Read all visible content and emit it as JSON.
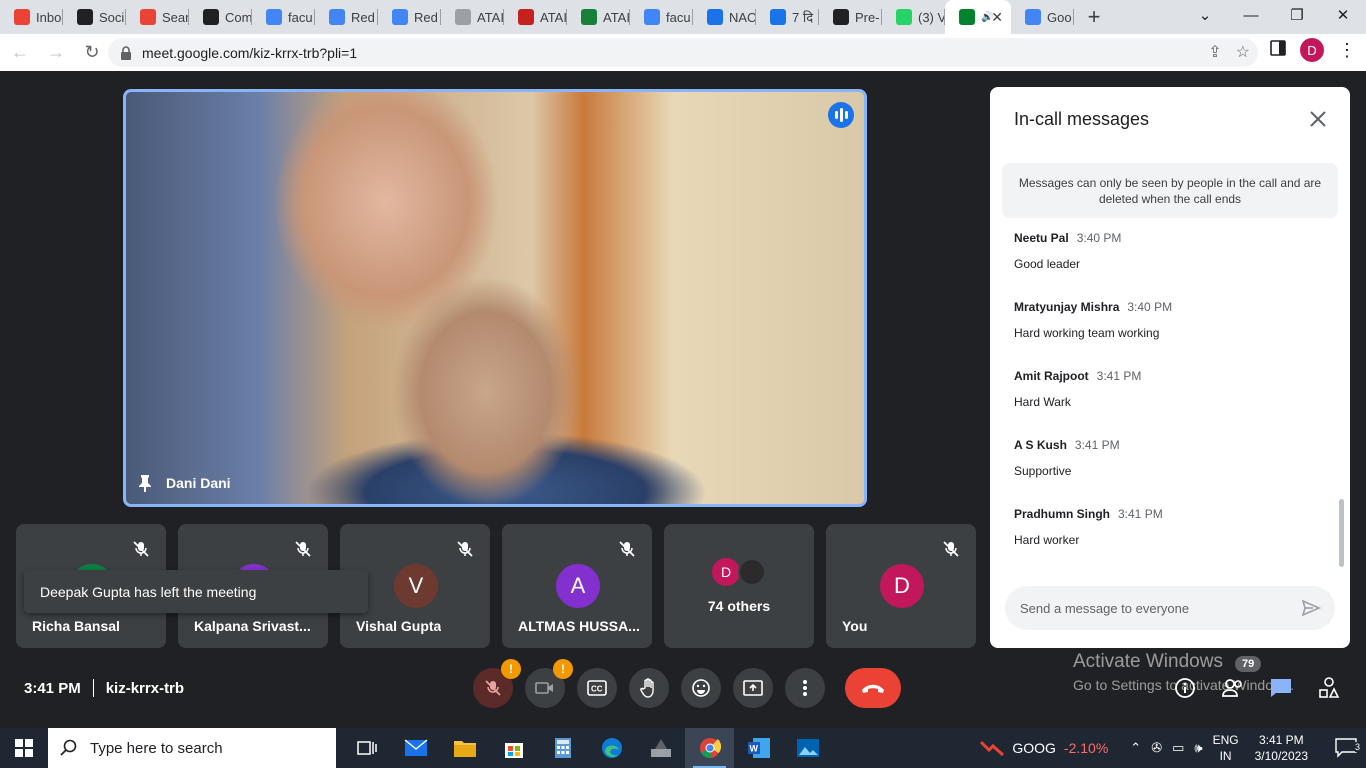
{
  "browser": {
    "tabs": [
      {
        "label": "Inbo",
        "icon": "gmail-icon",
        "color": "#ea4335"
      },
      {
        "label": "Soci",
        "icon": "app-icon",
        "color": "#202124"
      },
      {
        "label": "Sear",
        "icon": "gmail-icon",
        "color": "#ea4335"
      },
      {
        "label": "Com",
        "icon": "g-icon",
        "color": "#202124"
      },
      {
        "label": "facu",
        "icon": "google-icon",
        "color": "#4285f4"
      },
      {
        "label": "Red",
        "icon": "google-icon",
        "color": "#4285f4"
      },
      {
        "label": "Red",
        "icon": "google-icon",
        "color": "#4285f4"
      },
      {
        "label": "ATAI",
        "icon": "atal-icon",
        "color": "#9aa0a6"
      },
      {
        "label": "ATAI",
        "icon": "atal-icon",
        "color": "#c5221f"
      },
      {
        "label": "ATAI",
        "icon": "shield-icon",
        "color": "#188038"
      },
      {
        "label": "facu",
        "icon": "google-icon",
        "color": "#4285f4"
      },
      {
        "label": "NAC",
        "icon": "nac-icon",
        "color": "#1a73e8"
      },
      {
        "label": "7 दि",
        "icon": "nac-icon",
        "color": "#1a73e8"
      },
      {
        "label": "Pre-",
        "icon": "u-icon",
        "color": "#202124"
      },
      {
        "label": "(3) V",
        "icon": "whatsapp-icon",
        "color": "#25d366"
      },
      {
        "label": "",
        "icon": "meet-icon",
        "color": "#00832d",
        "active": true
      },
      {
        "label": "Goo",
        "icon": "google-icon",
        "color": "#4285f4"
      }
    ],
    "url": "meet.google.com/kiz-krrx-trb?pli=1",
    "profile_initial": "D"
  },
  "speaker": {
    "name": "Dani Dani"
  },
  "tiles": [
    {
      "name": "Richa Bansal",
      "initial": "",
      "color": "#0b8043"
    },
    {
      "name": "Kalpana Srivast...",
      "initial": "",
      "color": "#8430ce"
    },
    {
      "name": "Vishal Gupta",
      "initial": "V",
      "color": "#6d3a2f"
    },
    {
      "name": "ALTMAS HUSSA...",
      "initial": "A",
      "color": "#8430ce"
    },
    {
      "name": "You",
      "initial": "D",
      "color": "#c2185b"
    }
  ],
  "others": {
    "count_label": "74 others",
    "initial": "D"
  },
  "toast": "Deepak Gupta has left the meeting",
  "chat": {
    "title": "In-call messages",
    "notice": "Messages can only be seen by people in the call and are deleted when the call ends",
    "messages": [
      {
        "sender": "Neetu Pal",
        "time": "3:40 PM",
        "text": "Good leader"
      },
      {
        "sender": "Mratyunjay Mishra",
        "time": "3:40 PM",
        "text": "Hard working team working"
      },
      {
        "sender": "Amit Rajpoot",
        "time": "3:41 PM",
        "text": "Hard Wark"
      },
      {
        "sender": "A S Kush",
        "time": "3:41 PM",
        "text": "Supportive"
      },
      {
        "sender": "Pradhumn Singh",
        "time": "3:41 PM",
        "text": "Hard worker"
      }
    ],
    "input_placeholder": "Send a message to everyone"
  },
  "meeting": {
    "time": "3:41 PM",
    "code": "kiz-krrx-trb"
  },
  "controls": {
    "mic_badge": "!",
    "cam_badge": "!"
  },
  "watermark": {
    "line1": "Activate Windows",
    "line2": "Go to Settings to activate Windows.",
    "participants_count": "79"
  },
  "taskbar": {
    "search_placeholder": "Type here to search",
    "stock_name": "GOOG",
    "stock_change": "-2.10%",
    "lang1": "ENG",
    "lang2": "IN",
    "time": "3:41 PM",
    "date": "3/10/2023",
    "notifications": "3"
  }
}
